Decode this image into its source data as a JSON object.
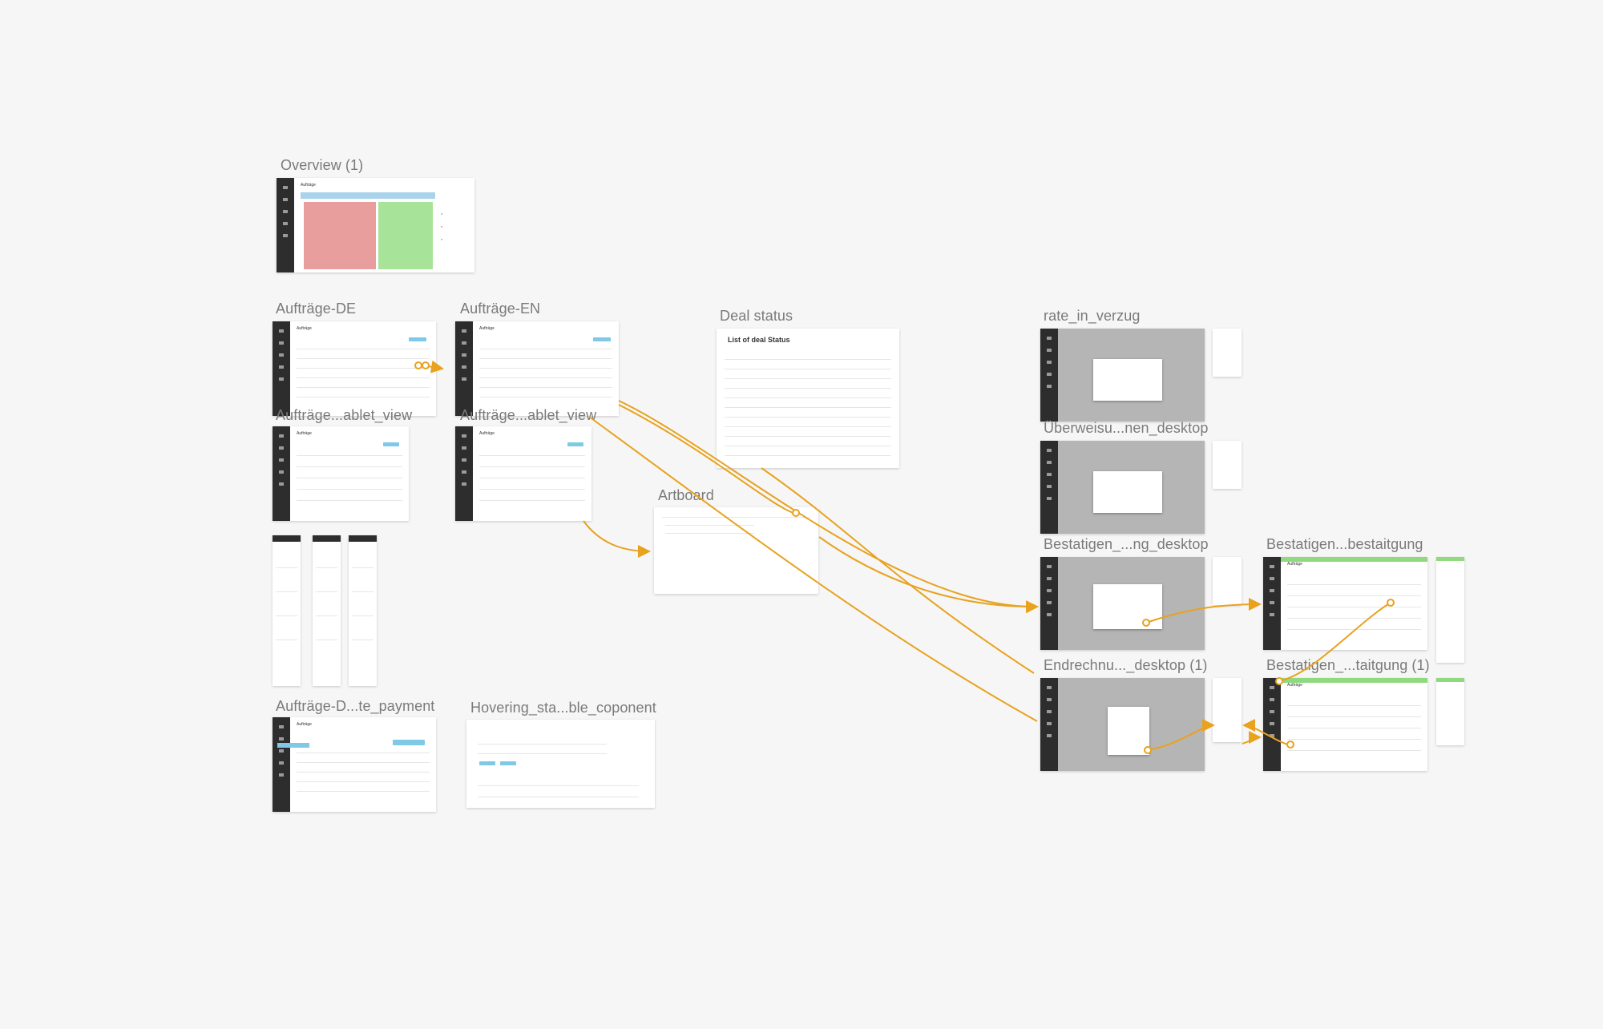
{
  "canvas": {
    "background": "#f6f6f6",
    "link_color": "#e8a21e"
  },
  "artboards": [
    {
      "id": "overview",
      "title": "Overview (1)"
    },
    {
      "id": "auftraege-de",
      "title": "Aufträge-DE"
    },
    {
      "id": "auftraege-en",
      "title": "Aufträge-EN"
    },
    {
      "id": "tablet-de",
      "title": "Aufträge...ablet_view"
    },
    {
      "id": "tablet-en",
      "title": "Aufträge...ablet_view"
    },
    {
      "id": "deal-status",
      "title": "Deal status",
      "heading": "List of deal Status"
    },
    {
      "id": "artboard",
      "title": "Artboard"
    },
    {
      "id": "rate-in-verzug",
      "title": "rate_in_verzug"
    },
    {
      "id": "ueberweisu",
      "title": "Überweisu...nen_desktop"
    },
    {
      "id": "bestatigen-ng",
      "title": "Bestatigen_...ng_desktop"
    },
    {
      "id": "bestatigen-bestaitgung",
      "title": "Bestatigen...bestaitgung"
    },
    {
      "id": "endrechnu",
      "title": "Endrechnu..._desktop (1)"
    },
    {
      "id": "bestatigen-taitgung-1",
      "title": "Bestatigen_...taitgung (1)"
    },
    {
      "id": "auftraege-payment",
      "title": "Aufträge-D...te_payment"
    },
    {
      "id": "hovering",
      "title": "Hovering_sta...ble_coponent"
    }
  ],
  "app_header": "Aufträge",
  "icons": {
    "link_arrow": "arrow-icon",
    "link_start": "connector-dot-icon"
  }
}
